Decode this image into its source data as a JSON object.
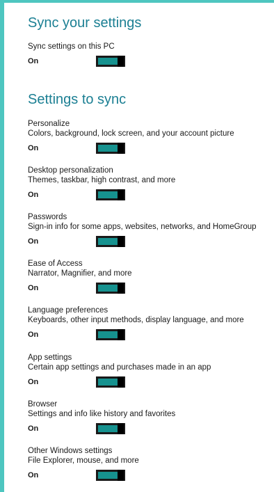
{
  "sync_section": {
    "heading": "Sync your settings",
    "master": {
      "title": "Sync settings on this PC",
      "state": "On",
      "on": true
    }
  },
  "settings_section": {
    "heading": "Settings to sync",
    "items": [
      {
        "title": "Personalize",
        "description": "Colors, background, lock screen, and your account picture",
        "state": "On",
        "on": true
      },
      {
        "title": "Desktop personalization",
        "description": "Themes, taskbar, high contrast, and more",
        "state": "On",
        "on": true
      },
      {
        "title": "Passwords",
        "description": "Sign-in info for some apps, websites, networks, and HomeGroup",
        "state": "On",
        "on": true
      },
      {
        "title": "Ease of Access",
        "description": "Narrator, Magnifier, and more",
        "state": "On",
        "on": true
      },
      {
        "title": "Language preferences",
        "description": "Keyboards, other input methods, display language, and more",
        "state": "On",
        "on": true
      },
      {
        "title": "App settings",
        "description": "Certain app settings and purchases made in an app",
        "state": "On",
        "on": true
      },
      {
        "title": "Browser",
        "description": "Settings and info like history and favorites",
        "state": "On",
        "on": true
      },
      {
        "title": "Other Windows settings",
        "description": "File Explorer, mouse, and more",
        "state": "On",
        "on": true
      }
    ]
  },
  "colors": {
    "accent": "#16928f",
    "heading": "#1b7f93",
    "border": "#4ec6c0"
  }
}
